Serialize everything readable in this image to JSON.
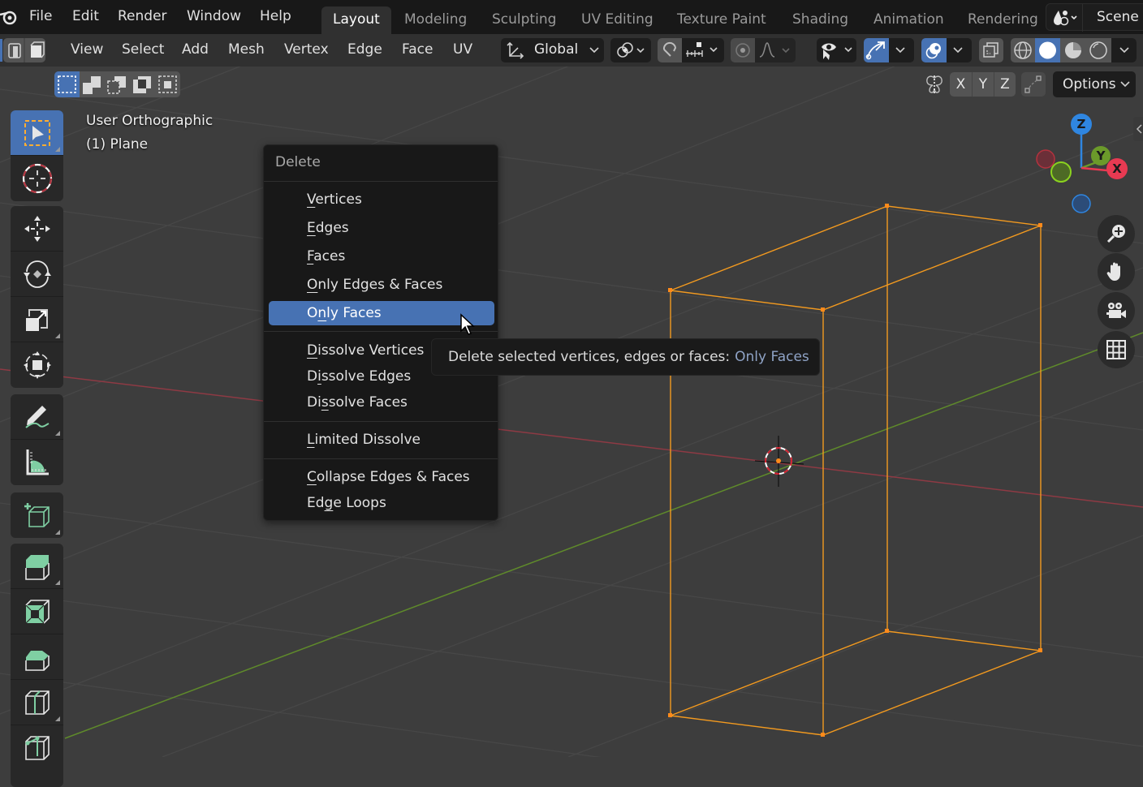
{
  "topbar": {
    "menus": [
      "File",
      "Edit",
      "Render",
      "Window",
      "Help"
    ],
    "workspace_tabs": [
      "Layout",
      "Modeling",
      "Sculpting",
      "UV Editing",
      "Texture Paint",
      "Shading",
      "Animation",
      "Rendering"
    ],
    "active_tab": "Layout",
    "scene_label": "Scene"
  },
  "header": {
    "menus": [
      "View",
      "Select",
      "Add",
      "Mesh",
      "Vertex",
      "Edge",
      "Face",
      "UV"
    ],
    "transform_orientation": "Global",
    "mirror_axes": [
      "X",
      "Y",
      "Z"
    ],
    "options_label": "Options"
  },
  "viewport": {
    "view_name": "User Orthographic",
    "object_name": "(1) Plane"
  },
  "gizmo": {
    "axes": [
      "Z",
      "Y",
      "X"
    ],
    "colors": {
      "x": "#e83a52",
      "y": "#6b9a2a",
      "z": "#2f86e1"
    }
  },
  "delete_menu": {
    "title": "Delete",
    "items": [
      {
        "label": "Vertices",
        "mnemonic": "V"
      },
      {
        "label": "Edges",
        "mnemonic": "E"
      },
      {
        "label": "Faces",
        "mnemonic": "F"
      },
      {
        "label": "Only Edges & Faces",
        "mnemonic": "O"
      },
      {
        "label": "Only Faces",
        "mnemonic": "n",
        "highlighted": true
      },
      {
        "label": "Dissolve Vertices",
        "mnemonic": "D"
      },
      {
        "label": "Dissolve Edges",
        "mnemonic": "i"
      },
      {
        "label": "Dissolve Faces",
        "mnemonic": "s"
      },
      {
        "label": "Limited Dissolve",
        "mnemonic": "L"
      },
      {
        "label": "Collapse Edges & Faces",
        "mnemonic": "C"
      },
      {
        "label": "Edge Loops",
        "mnemonic": "g"
      }
    ]
  },
  "tooltip": {
    "text": "Delete selected vertices, edges or faces:",
    "value": "Only Faces"
  },
  "colors": {
    "accent": "#4772b3",
    "selection": "#f39a1f",
    "x_axis": "#9c3a46",
    "y_axis": "#6a8f2c"
  }
}
